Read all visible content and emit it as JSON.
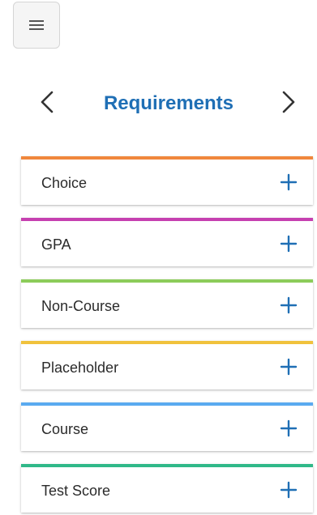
{
  "header": {
    "menu_icon": "hamburger-icon"
  },
  "nav": {
    "title": "Requirements",
    "prev_icon": "chevron-left-icon",
    "next_icon": "chevron-right-icon"
  },
  "requirements": [
    {
      "label": "Choice",
      "color": "#f0873c",
      "icon": "plus-icon"
    },
    {
      "label": "GPA",
      "color": "#c640b0",
      "icon": "plus-icon"
    },
    {
      "label": "Non-Course",
      "color": "#8ccc5a",
      "icon": "plus-icon"
    },
    {
      "label": "Placeholder",
      "color": "#f0c23c",
      "icon": "plus-icon"
    },
    {
      "label": "Course",
      "color": "#5aaaf0",
      "icon": "plus-icon"
    },
    {
      "label": "Test Score",
      "color": "#2fb888",
      "icon": "plus-icon"
    }
  ],
  "colors": {
    "accent": "#1f6fb5",
    "text": "#2b2b2b"
  }
}
